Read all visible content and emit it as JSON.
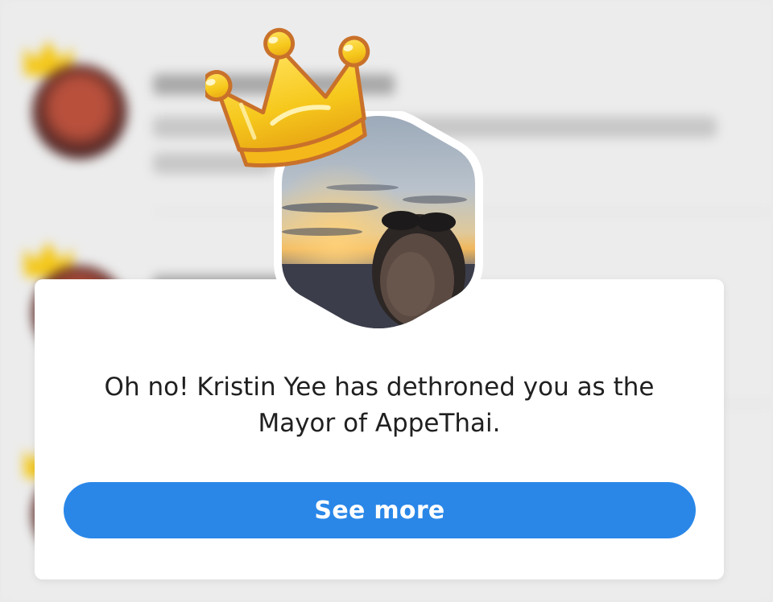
{
  "dialog": {
    "message": "Oh no! Kristin Yee has dethroned you as the Mayor of AppeThai.",
    "button_label": "See more"
  },
  "icons": {
    "crown": "crown-icon",
    "avatar": "user-avatar-photo"
  },
  "colors": {
    "button": "#2a87e8",
    "button_text": "#ffffff",
    "card": "#ffffff",
    "backdrop": "#ececec",
    "crown_gold": "#f6c81c",
    "crown_outline": "#c9712a"
  }
}
